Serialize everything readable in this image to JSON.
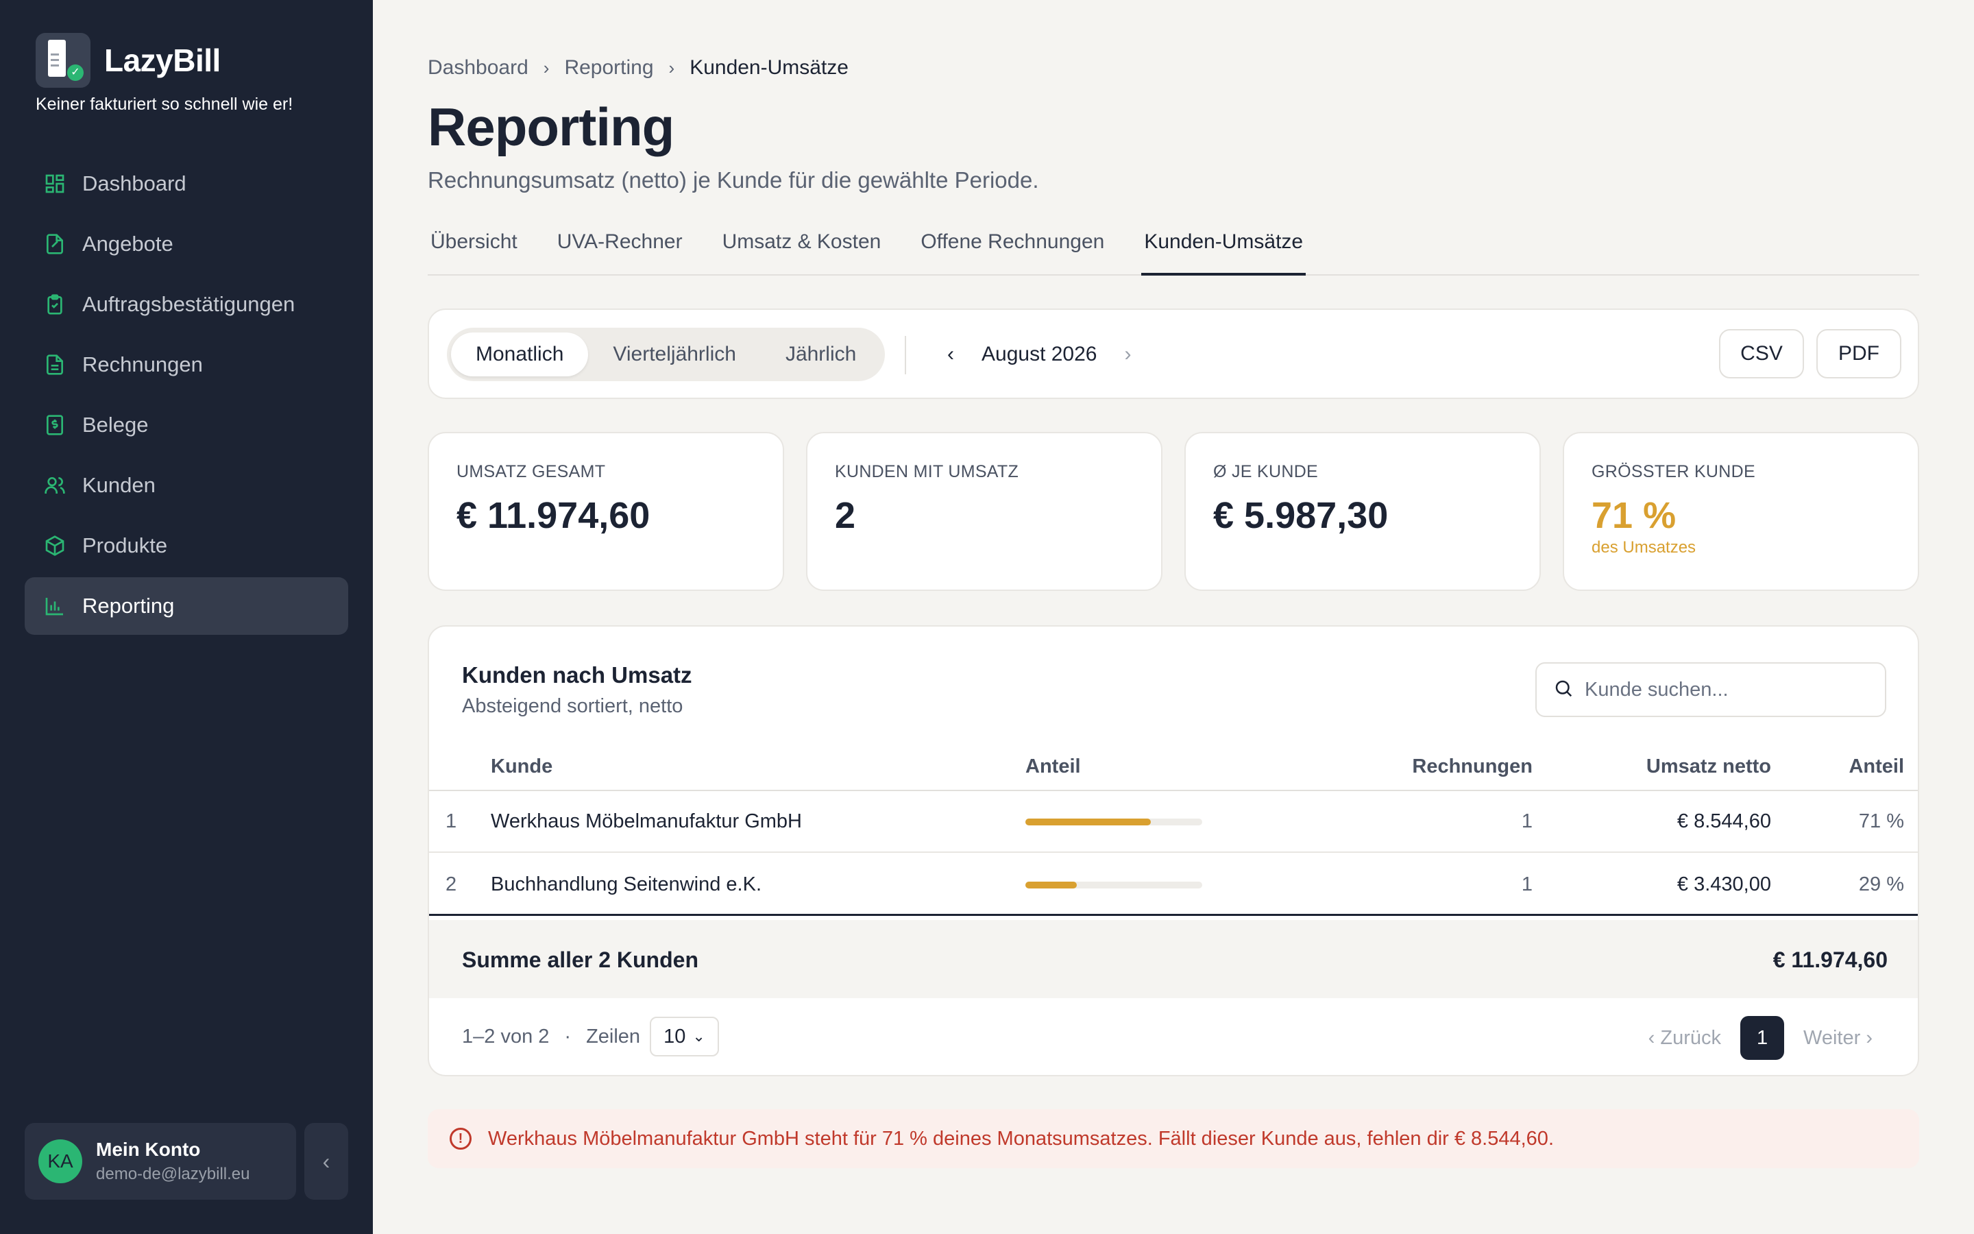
{
  "brand": {
    "name": "LazyBill",
    "tagline": "Keiner fakturiert so schnell wie er!"
  },
  "sidebar": {
    "items": [
      {
        "label": "Dashboard",
        "icon": "dashboard-icon"
      },
      {
        "label": "Angebote",
        "icon": "quote-icon"
      },
      {
        "label": "Auftragsbestätigungen",
        "icon": "clipboard-check-icon"
      },
      {
        "label": "Rechnungen",
        "icon": "invoice-icon"
      },
      {
        "label": "Belege",
        "icon": "receipt-icon"
      },
      {
        "label": "Kunden",
        "icon": "users-icon"
      },
      {
        "label": "Produkte",
        "icon": "box-icon"
      },
      {
        "label": "Reporting",
        "icon": "bar-chart-icon",
        "active": true
      }
    ],
    "account": {
      "initials": "KA",
      "name": "Mein Konto",
      "email": "demo-de@lazybill.eu"
    }
  },
  "breadcrumb": [
    "Dashboard",
    "Reporting",
    "Kunden-Umsätze"
  ],
  "page": {
    "title": "Reporting",
    "subtitle": "Rechnungsumsatz (netto) je Kunde für die gewählte Periode."
  },
  "tabs": [
    "Übersicht",
    "UVA-Rechner",
    "Umsatz & Kosten",
    "Offene Rechnungen",
    "Kunden-Umsätze"
  ],
  "active_tab": "Kunden-Umsätze",
  "toolbar": {
    "period_modes": [
      "Monatlich",
      "Vierteljährlich",
      "Jährlich"
    ],
    "active_mode": "Monatlich",
    "period_label": "August 2026",
    "csv_label": "CSV",
    "pdf_label": "PDF"
  },
  "kpis": [
    {
      "label": "UMSATZ GESAMT",
      "value": "€ 11.974,60"
    },
    {
      "label": "KUNDEN MIT UMSATZ",
      "value": "2"
    },
    {
      "label": "Ø JE KUNDE",
      "value": "€ 5.987,30"
    },
    {
      "label": "GRÖSSTER KUNDE",
      "value": "71 %",
      "note": "des Umsatzes"
    }
  ],
  "accent_color": "#d9a030",
  "table": {
    "title": "Kunden nach Umsatz",
    "subtitle": "Absteigend sortiert, netto",
    "search_placeholder": "Kunde suchen...",
    "columns": {
      "customer": "Kunde",
      "share_bar": "Anteil",
      "invoices": "Rechnungen",
      "revenue": "Umsatz netto",
      "share": "Anteil"
    },
    "rows": [
      {
        "idx": "1",
        "customer": "Werkhaus Möbelmanufaktur GmbH",
        "share_fraction": 0.71,
        "invoices": "1",
        "revenue": "€ 8.544,60",
        "share": "71 %"
      },
      {
        "idx": "2",
        "customer": "Buchhandlung Seitenwind e.K.",
        "share_fraction": 0.29,
        "invoices": "1",
        "revenue": "€ 3.430,00",
        "share": "29 %"
      }
    ],
    "footer": {
      "label": "Summe aller 2 Kunden",
      "total": "€ 11.974,60"
    },
    "pagination": {
      "range": "1–2 von 2",
      "dot": "·",
      "rows_label": "Zeilen",
      "rows_value": "10",
      "prev": "Zurück",
      "page": "1",
      "next": "Weiter"
    }
  },
  "alert": {
    "text": "Werkhaus Möbelmanufaktur GmbH steht für 71 % deines Monatsumsatzes. Fällt dieser Kunde aus, fehlen dir € 8.544,60."
  }
}
